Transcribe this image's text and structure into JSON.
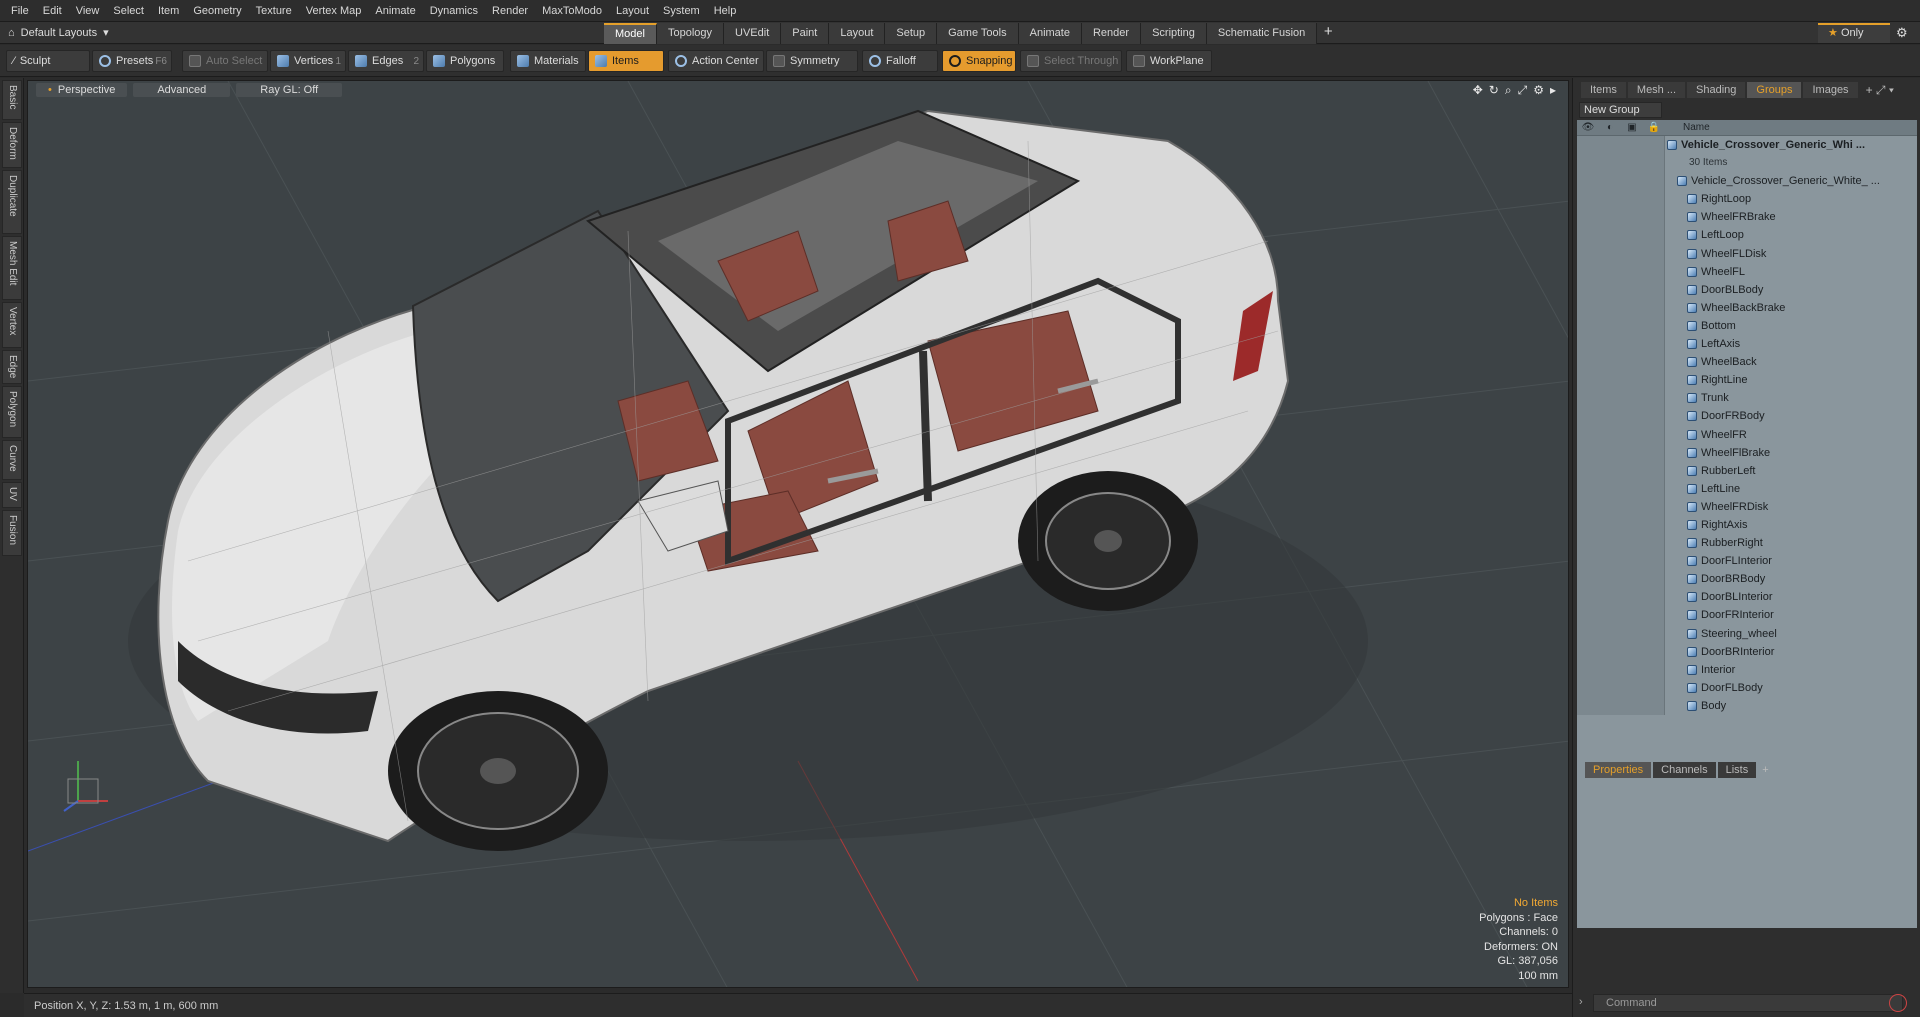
{
  "menu": [
    "File",
    "Edit",
    "View",
    "Select",
    "Item",
    "Geometry",
    "Texture",
    "Vertex Map",
    "Animate",
    "Dynamics",
    "Render",
    "MaxToModo",
    "Layout",
    "System",
    "Help"
  ],
  "layouts_label": "Default Layouts",
  "layout_tabs": [
    "Model",
    "Topology",
    "UVEdit",
    "Paint",
    "Layout",
    "Setup",
    "Game Tools",
    "Animate",
    "Render",
    "Scripting",
    "Schematic Fusion"
  ],
  "only_label": "Only",
  "toolbar": {
    "sculpt": "Sculpt",
    "presets": "Presets",
    "presets_shortcut": "F6",
    "auto_select": "Auto Select",
    "vertices": "Vertices",
    "vertices_shortcut": "1",
    "edges": "Edges",
    "edges_shortcut": "2",
    "polygons": "Polygons",
    "materials": "Materials",
    "items": "Items",
    "action_center": "Action Center",
    "symmetry": "Symmetry",
    "falloff": "Falloff",
    "snapping": "Snapping",
    "select_through": "Select Through",
    "workplane": "WorkPlane"
  },
  "left_tabs": [
    "Basic",
    "Deform",
    "Duplicate",
    "Mesh Edit",
    "Vertex",
    "Edge",
    "Polygon",
    "Curve",
    "UV",
    "Fusion"
  ],
  "viewport": {
    "perspective": "Perspective",
    "advanced": "Advanced",
    "raygl": "Ray GL: Off",
    "info": {
      "no_items": "No Items",
      "polygons": "Polygons : Face",
      "channels": "Channels: 0",
      "deformers": "Deformers: ON",
      "gl": "GL: 387,056",
      "scale": "100 mm"
    }
  },
  "status": {
    "position": "Position X, Y, Z:   1.53 m, 1 m, 600 mm"
  },
  "right_panel": {
    "tabs": [
      "Items",
      "Mesh ...",
      "Shading",
      "Groups",
      "Images"
    ],
    "active_tab": "Groups",
    "new_group": "New Group",
    "name_header": "Name",
    "group_name": "Vehicle_Crossover_Generic_Whi ...",
    "group_count": "30 Items",
    "mesh_root": "Vehicle_Crossover_Generic_White_ ...",
    "items": [
      "RightLoop",
      "WheelFRBrake",
      "LeftLoop",
      "WheelFLDisk",
      "WheelFL",
      "DoorBLBody",
      "WheelBackBrake",
      "Bottom",
      "LeftAxis",
      "WheelBack",
      "RightLine",
      "Trunk",
      "DoorFRBody",
      "WheelFR",
      "WheelFlBrake",
      "RubberLeft",
      "LeftLine",
      "WheelFRDisk",
      "RightAxis",
      "RubberRight",
      "DoorFLInterior",
      "DoorBRBody",
      "DoorBLInterior",
      "DoorFRInterior",
      "Steering_wheel",
      "DoorBRInterior",
      "Interior",
      "DoorFLBody",
      "Body"
    ],
    "bottom_tabs": [
      "Properties",
      "Channels",
      "Lists"
    ],
    "command_placeholder": "Command"
  },
  "colors": {
    "accent": "#e59b2e",
    "viewport_bg": "#3d4346",
    "tree_bg": "#8a969d"
  }
}
